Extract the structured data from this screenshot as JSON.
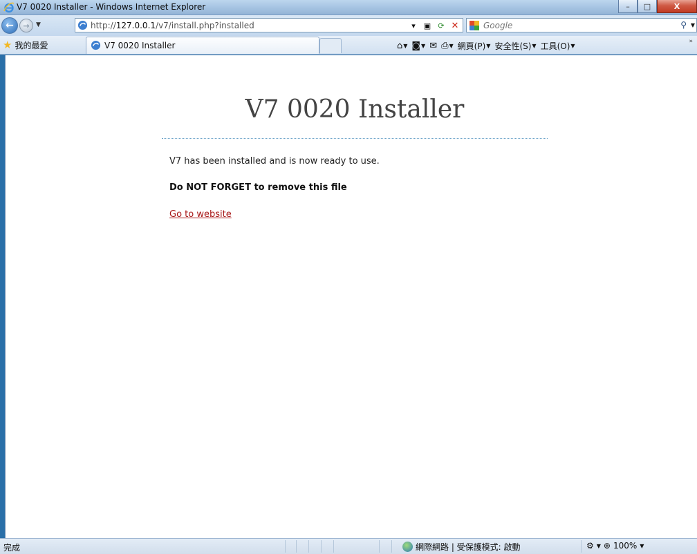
{
  "window": {
    "title": "V7 0020 Installer - Windows Internet Explorer",
    "minimize": "–",
    "maximize": "□",
    "close": "X"
  },
  "address": {
    "url_prefix": "http://",
    "url_host": "127.0.0.1",
    "url_path": "/v7/install.php?installed",
    "search_placeholder": "Google"
  },
  "toolbar": {
    "favorites": "我的最愛",
    "tab_title": "V7 0020 Installer",
    "page_menu": "網頁(P)",
    "safety_menu": "安全性(S)",
    "tools_menu": "工具(O)"
  },
  "page": {
    "heading": "V7 0020 Installer",
    "message": "V7 has been installed and is now ready to use.",
    "warning": "Do NOT FORGET to remove this file",
    "link": "Go to website"
  },
  "status": {
    "text": "完成",
    "zone": "網際網路 | 受保護模式: 啟動",
    "zoom": "100%"
  }
}
